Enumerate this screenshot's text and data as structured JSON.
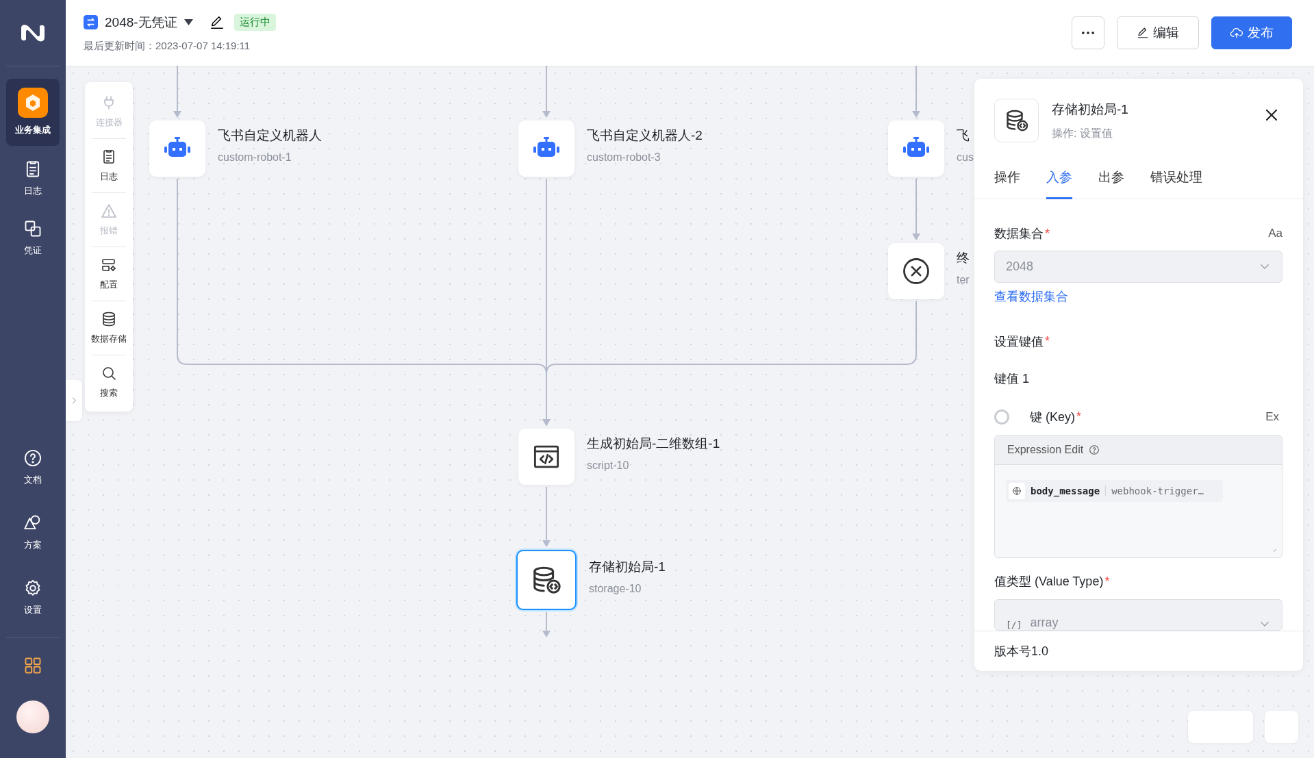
{
  "sidebar": {
    "items": [
      {
        "label": "业务集成",
        "selected": true
      },
      {
        "label": "日志",
        "selected": false
      },
      {
        "label": "凭证",
        "selected": false
      }
    ],
    "bottom_items": [
      {
        "label": "文档"
      },
      {
        "label": "方案"
      },
      {
        "label": "设置"
      }
    ]
  },
  "header": {
    "title": "2048-无凭证",
    "status": "运行中",
    "updated": "最后更新时间：2023-07-07 14:19:11",
    "buttons": [
      {
        "label": "编辑",
        "kind": "secondary"
      },
      {
        "label": "发布",
        "kind": "primary"
      }
    ]
  },
  "palette": {
    "items": [
      {
        "label": "连接器",
        "disabled": true
      },
      {
        "label": "日志",
        "disabled": false
      },
      {
        "label": "报错",
        "disabled": true
      },
      {
        "label": "配置",
        "disabled": false
      },
      {
        "label": "数据存储",
        "disabled": false
      },
      {
        "label": "搜索",
        "disabled": false
      }
    ]
  },
  "nodes": [
    {
      "kind": "robot",
      "title": "飞书自定义机器人",
      "subtitle": "custom-robot-1",
      "selected": false
    },
    {
      "kind": "robot",
      "title": "飞书自定义机器人-2",
      "subtitle": "custom-robot-3",
      "selected": false
    },
    {
      "kind": "robot",
      "title": "飞",
      "subtitle": "cus",
      "selected": false
    },
    {
      "kind": "terminate",
      "title": "终",
      "subtitle": "ter",
      "selected": false
    },
    {
      "kind": "script",
      "title": "生成初始局-二维数组-1",
      "subtitle": "script-10",
      "selected": false
    },
    {
      "kind": "storage",
      "title": "存储初始局-1",
      "subtitle": "storage-10",
      "selected": true
    }
  ],
  "panel": {
    "title": "存储初始局-1",
    "subtitle": "操作: 设置值",
    "tabs": [
      {
        "label": "操作",
        "selected": false
      },
      {
        "label": "入参",
        "selected": true
      },
      {
        "label": "出参",
        "selected": false
      },
      {
        "label": "错误处理",
        "selected": false
      }
    ],
    "dataset": {
      "label": "数据集合",
      "required_mark": "*",
      "mode_toggle": "Aa",
      "value": "2048",
      "disabled": true,
      "link": "查看数据集合"
    },
    "keyvalues": {
      "label": "设置键值",
      "required_mark": "*",
      "item_title": "键值 1",
      "key_label": "键 (Key)",
      "key_required_mark": "*",
      "toggle_on": false,
      "ex": "Ex",
      "editor_title": "Expression Edit",
      "chip_name": "body_message",
      "chip_source": "webhook-trigger…"
    },
    "value_type": {
      "label": "值类型 (Value Type)",
      "required_mark": "*",
      "type_icon": "[/]",
      "value": "array"
    },
    "version": "版本号1.0"
  }
}
